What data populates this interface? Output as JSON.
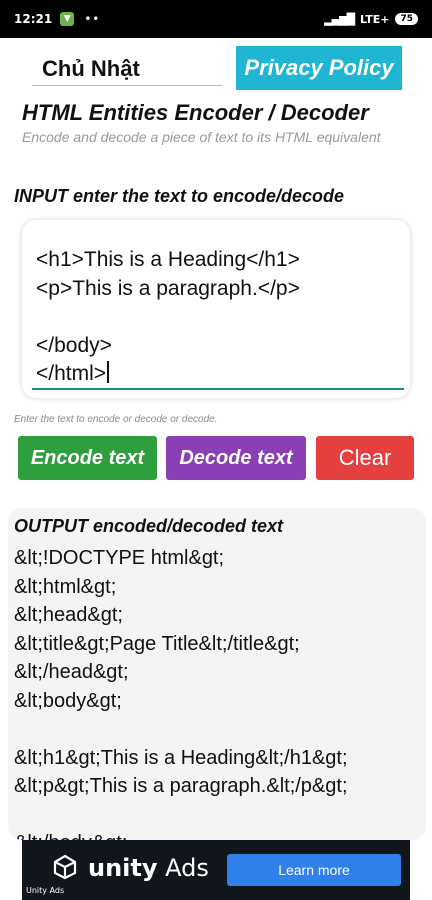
{
  "status_bar": {
    "time": "12:21",
    "dots": "••",
    "signal": "▂▄▆█",
    "network": "LTE+",
    "battery": "75"
  },
  "header": {
    "day_label": "Chủ Nhật",
    "privacy_label": "Privacy Policy"
  },
  "page": {
    "title": "HTML Entities Encoder / Decoder",
    "subtitle": "Encode and decode a piece of text to its HTML equivalent"
  },
  "input": {
    "label": "INPUT enter the text to encode/decode",
    "lines": [
      "<h1>This is a Heading</h1>",
      "<p>This is a paragraph.</p>",
      "",
      "</body>",
      "</html>"
    ],
    "hint": "Enter the text to encode or decode or decode."
  },
  "buttons": {
    "encode": "Encode text",
    "decode": "Decode text",
    "clear": "Clear"
  },
  "output": {
    "label": "OUTPUT encoded/decoded text",
    "lines": [
      "&lt;!DOCTYPE html&gt;",
      "&lt;html&gt;",
      "&lt;head&gt;",
      "&lt;title&gt;Page Title&lt;/title&gt;",
      "&lt;/head&gt;",
      "&lt;body&gt;",
      "",
      "&lt;h1&gt;This is a Heading&lt;/h1&gt;",
      "&lt;p&gt;This is a paragraph.&lt;/p&gt;",
      "",
      "&lt;/body&gt;"
    ]
  },
  "ad": {
    "brand_a": "unity",
    "brand_b": " Ads",
    "small": "Unity Ads",
    "cta": "Learn more"
  },
  "colors": {
    "accent_cyan": "#20b5d3",
    "encode_green": "#2e9e3e",
    "decode_purple": "#8a3fb5",
    "clear_red": "#e53f3f",
    "underline_teal": "#1d8f82"
  }
}
